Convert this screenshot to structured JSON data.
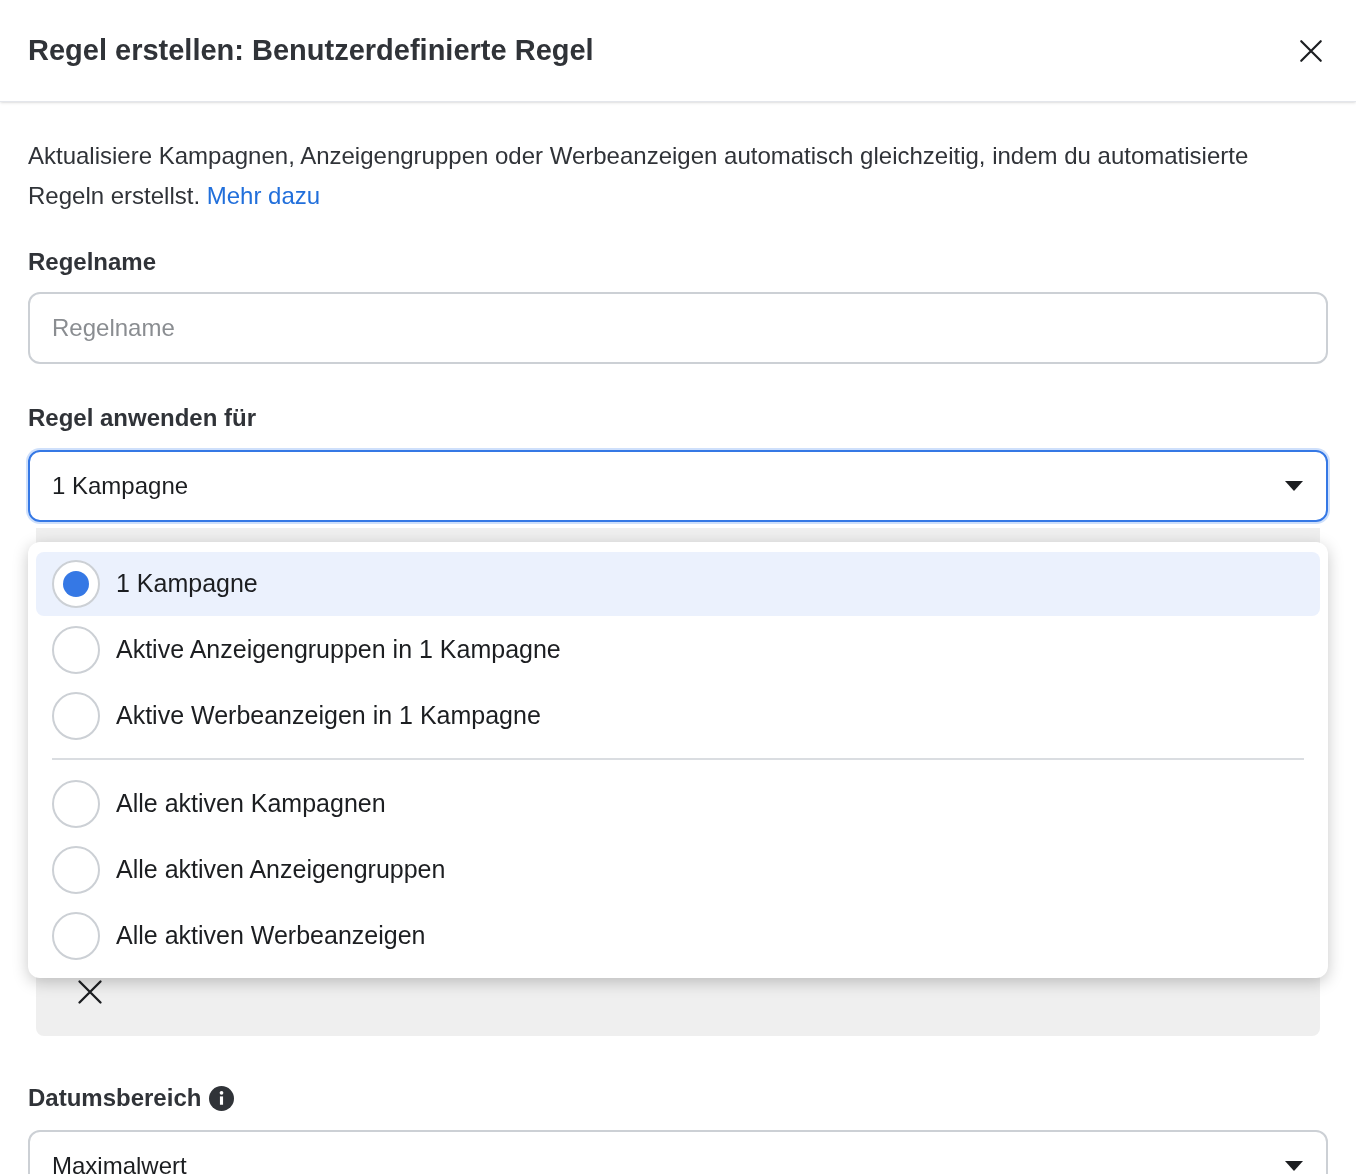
{
  "dialog": {
    "title": "Regel erstellen: Benutzerdefinierte Regel"
  },
  "intro": {
    "text": "Aktualisiere Kampagnen, Anzeigengruppen oder Werbeanzeigen automatisch gleichzeitig, indem du automatisierte Regeln erstellst.",
    "link": "Mehr dazu"
  },
  "rule_name": {
    "label": "Regelname",
    "placeholder": "Regelname"
  },
  "apply_to": {
    "label": "Regel anwenden für",
    "value": "1 Kampagne",
    "expanded": true,
    "option_groups": [
      {
        "options": [
          {
            "label": "1 Kampagne",
            "selected": true
          },
          {
            "label": "Aktive Anzeigengruppen in 1 Kampagne",
            "selected": false
          },
          {
            "label": "Aktive Werbeanzeigen in 1 Kampagne",
            "selected": false
          }
        ]
      },
      {
        "options": [
          {
            "label": "Alle aktiven Kampagnen",
            "selected": false
          },
          {
            "label": "Alle aktiven Anzeigengruppen",
            "selected": false
          },
          {
            "label": "Alle aktiven Werbeanzeigen",
            "selected": false
          }
        ]
      }
    ]
  },
  "date_range": {
    "label": "Datumsbereich",
    "value": "Maximalwert"
  }
}
